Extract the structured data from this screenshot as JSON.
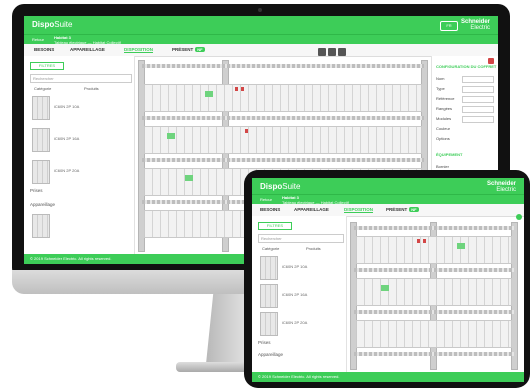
{
  "app": {
    "logo_main": "Dispo",
    "logo_sub": "Suite",
    "brand": "Schneider",
    "brand_sub": "Electric",
    "language": "FR",
    "project_label": "Retour",
    "project_name": "Habitat 3",
    "project_desc": "Tableau électrique — Habitat Collectif",
    "tabs": [
      {
        "label": "BESOINS"
      },
      {
        "label": "APPAREILLAGE"
      },
      {
        "label": "DISPOSITION"
      },
      {
        "label": "PRÉSENT",
        "badge": "NF"
      }
    ],
    "filter_label": "FILTRES",
    "search_placeholder": "Rechercher",
    "col_left": "Catégorie",
    "col_right": "Produits",
    "products": [
      {
        "label": "iC60N 2P 10A"
      },
      {
        "label": "iC60N 2P 16A"
      },
      {
        "label": "iC60N 2P 20A"
      }
    ],
    "section_a": "Prises",
    "section_b": "Appareillage",
    "footer_text": "© 2019 Schneider Electric. All rights reserved.",
    "right_title": "CONFIGURATION DU COFFRET",
    "right_fields": [
      "Nom",
      "Type",
      "Référence",
      "Rangées",
      "Modules",
      "Couleur",
      "Options"
    ],
    "right_section": "ÉQUIPEMENT",
    "right_section2": "Bornier"
  },
  "colors": {
    "accent": "#3dcd58",
    "bezel": "#111111",
    "alert": "#d34646"
  },
  "icons": [
    "camera-icon",
    "home-button-icon",
    "search-icon",
    "zoom-in-icon",
    "zoom-out-icon",
    "close-icon"
  ]
}
